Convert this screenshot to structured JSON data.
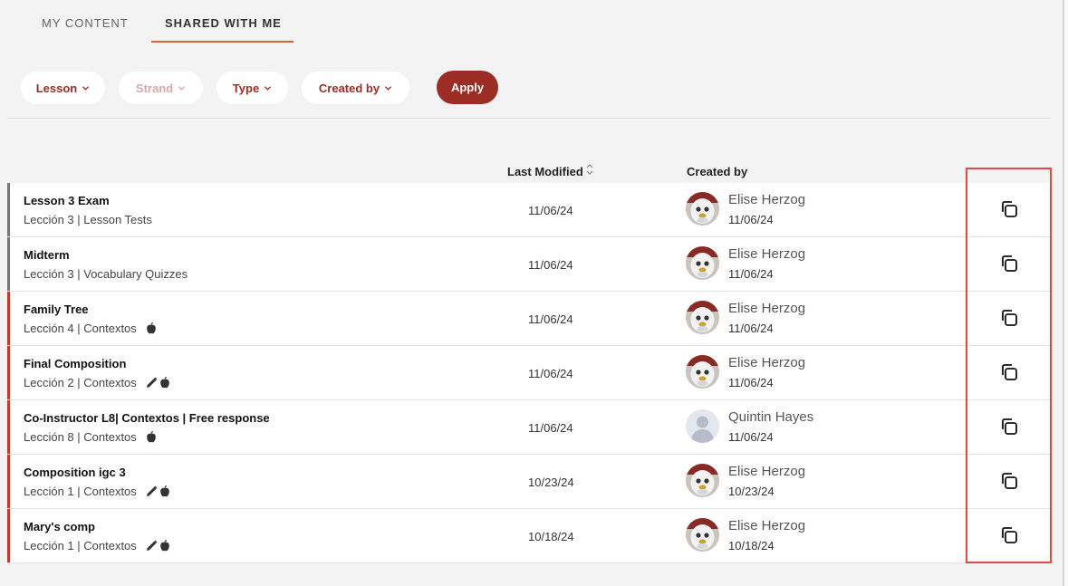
{
  "tabs": [
    {
      "label": "MY CONTENT",
      "active": false
    },
    {
      "label": "SHARED WITH ME",
      "active": true
    }
  ],
  "filters": {
    "lesson": "Lesson",
    "strand": "Strand",
    "type": "Type",
    "created_by": "Created by",
    "apply": "Apply"
  },
  "columns": {
    "last_modified": "Last Modified",
    "created_by": "Created by"
  },
  "colors": {
    "accent": "#9b2d25",
    "tab_underline": "#d9643a",
    "highlight_box": "#e14a44",
    "row_bar_grey": "#777777",
    "row_bar_red": "#c0392b"
  },
  "rows": [
    {
      "title": "Lesson 3 Exam",
      "sub": "Lección 3 | Lesson Tests",
      "badges": [],
      "modified": "11/06/24",
      "creator": "Elise Herzog",
      "creator_date": "11/06/24",
      "avatar": "photo",
      "bar": "grey"
    },
    {
      "title": "Midterm",
      "sub": "Lección 3 | Vocabulary Quizzes",
      "badges": [],
      "modified": "11/06/24",
      "creator": "Elise Herzog",
      "creator_date": "11/06/24",
      "avatar": "photo",
      "bar": "grey"
    },
    {
      "title": "Family Tree",
      "sub": "Lección 4 | Contextos",
      "badges": [
        "apple-icon"
      ],
      "modified": "11/06/24",
      "creator": "Elise Herzog",
      "creator_date": "11/06/24",
      "avatar": "photo",
      "bar": "red"
    },
    {
      "title": "Final Composition",
      "sub": "Lección 2 | Contextos",
      "badges": [
        "pencil-icon",
        "apple-icon"
      ],
      "modified": "11/06/24",
      "creator": "Elise Herzog",
      "creator_date": "11/06/24",
      "avatar": "photo",
      "bar": "red"
    },
    {
      "title": "Co-Instructor L8| Contextos | Free response",
      "sub": "Lección 8 | Contextos",
      "badges": [
        "apple-icon"
      ],
      "modified": "11/06/24",
      "creator": "Quintin Hayes",
      "creator_date": "11/06/24",
      "avatar": "placeholder",
      "bar": "red"
    },
    {
      "title": "Composition igc 3",
      "sub": "Lección 1 | Contextos",
      "badges": [
        "pencil-icon",
        "apple-icon"
      ],
      "modified": "10/23/24",
      "creator": "Elise Herzog",
      "creator_date": "10/23/24",
      "avatar": "photo",
      "bar": "red"
    },
    {
      "title": "Mary's comp",
      "sub": "Lección 1 | Contextos",
      "badges": [
        "pencil-icon",
        "apple-icon"
      ],
      "modified": "10/18/24",
      "creator": "Elise Herzog",
      "creator_date": "10/18/24",
      "avatar": "photo",
      "bar": "red"
    }
  ]
}
